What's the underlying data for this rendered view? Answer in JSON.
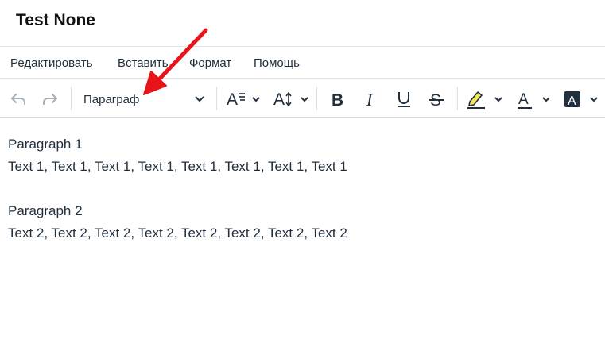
{
  "window": {
    "title": "Test None"
  },
  "menubar": {
    "items": [
      {
        "label": "Редактировать"
      },
      {
        "label": "Вставить"
      },
      {
        "label": "Формат"
      },
      {
        "label": "Помощь"
      }
    ]
  },
  "toolbar": {
    "block_format": {
      "value": "Параграф"
    },
    "icons": [
      "undo-icon",
      "redo-icon",
      "chevron-down-icon",
      "font-family-icon",
      "font-size-icon",
      "bold-icon",
      "italic-icon",
      "underline-icon",
      "strikethrough-icon",
      "highlight-icon",
      "text-color-icon",
      "background-color-icon"
    ],
    "highlight_color": "#f7e85e",
    "disabled_color": "#a7aeb6"
  },
  "content": {
    "paragraphs": [
      {
        "heading": "Paragraph 1",
        "text": "Text 1, Text 1, Text 1, Text 1, Text 1, Text 1, Text 1, Text 1"
      },
      {
        "heading": "Paragraph 2",
        "text": "Text 2, Text 2, Text 2, Text 2, Text 2, Text 2, Text 2, Text 2"
      }
    ]
  },
  "annotation": {
    "arrow_color": "#e8141a"
  }
}
